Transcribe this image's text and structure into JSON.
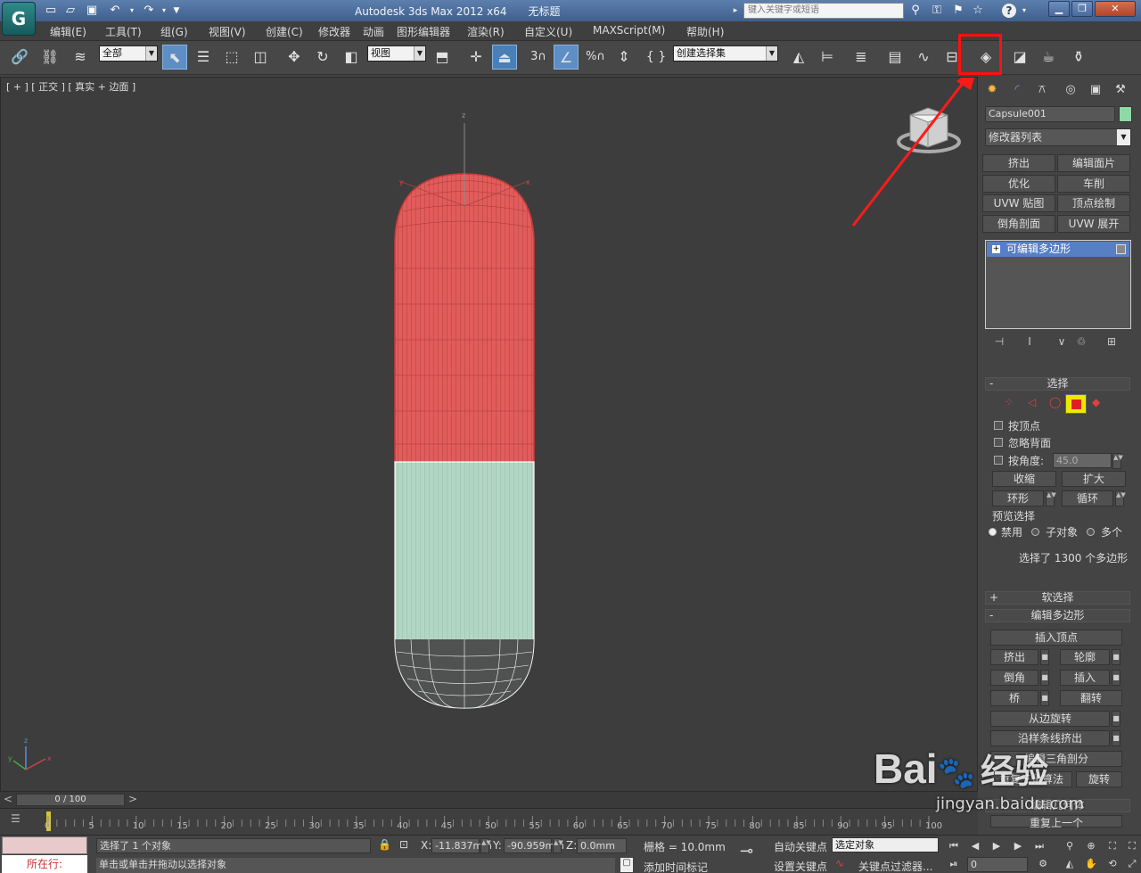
{
  "window": {
    "title": "Autodesk 3ds Max  2012 x64",
    "file": "无标题",
    "search_placeholder": "键入关键字或短语",
    "logo": "G"
  },
  "quick_access": [
    "new-icon",
    "open-icon",
    "save-icon",
    "undo-icon",
    "redo-icon"
  ],
  "menu": [
    "编辑(E)",
    "工具(T)",
    "组(G)",
    "视图(V)",
    "创建(C)",
    "修改器",
    "动画",
    "图形编辑器",
    "渲染(R)",
    "自定义(U)",
    "MAXScript(M)",
    "帮助(H)"
  ],
  "toolbar": {
    "selection_filter": "全部",
    "ref_coord": "视图",
    "named_selection": "创建选择集",
    "snap_label": "3",
    "percent_snap": "%",
    "highlighted_tool": "render-setup-icon"
  },
  "viewport": {
    "label": "[ + ] [ 正交 ] [ 真实 + 边面 ]",
    "axis_z": "z",
    "axis_x": "x",
    "axis_y": "y",
    "corner_axes": {
      "z": "z",
      "y": "y",
      "x": "x"
    },
    "selected_color": "#e85a5a",
    "unselected_color": "#b5d8c8"
  },
  "command_panel": {
    "object_name": "Capsule001",
    "object_color": "#8fd8a8",
    "modifier_list": "修改器列表",
    "modifier_buttons": [
      "挤出",
      "编辑面片",
      "优化",
      "车削",
      "UVW 贴图",
      "顶点绘制",
      "倒角剖面",
      "UVW 展开"
    ],
    "stack_item": "可编辑多边形",
    "selection": {
      "header": "选择",
      "by_vertex": "按顶点",
      "ignore_backfacing": "忽略背面",
      "by_angle": "按角度:",
      "angle_value": "45.0",
      "shrink": "收缩",
      "grow": "扩大",
      "ring": "环形",
      "loop": "循环",
      "preview_header": "预览选择",
      "preview_off": "禁用",
      "preview_sub": "子对象",
      "preview_multi": "多个",
      "status": "选择了 1300 个多边形"
    },
    "soft_selection": "软选择",
    "edit_polygons": {
      "header": "编辑多边形",
      "insert_vertex": "插入顶点",
      "extrude": "挤出",
      "outline": "轮廓",
      "bevel": "倒角",
      "inset": "插入",
      "bridge": "桥",
      "flip": "翻转",
      "hinge": "从边旋转",
      "extrude_spline": "沿样条线挤出",
      "edit_tri": "编辑三角剖分",
      "retri": "重复三角算法",
      "turn": "旋转"
    },
    "edit_geometry": "编辑几何体",
    "repeat_last": "重复上一个"
  },
  "timeline": {
    "frame": "0 / 100",
    "ticks": [
      "0",
      "5",
      "10",
      "15",
      "20",
      "25",
      "30",
      "35",
      "40",
      "45",
      "50",
      "55",
      "60",
      "65",
      "70",
      "75",
      "80",
      "85",
      "90",
      "95",
      "100"
    ]
  },
  "status": {
    "selected": "选择了 1 个对象",
    "prompt": "单击或单击并拖动以选择对象",
    "running": "所在行:",
    "x_label": "X:",
    "x": "-11.837mm",
    "y_label": "Y:",
    "y": "-90.959mm",
    "z_label": "Z:",
    "z": "0.0mm",
    "grid": "栅格 = 10.0mm",
    "auto_key": "自动关键点",
    "key_mode": "选定对象",
    "set_key": "设置关键点",
    "key_filters": "关键点过滤器...",
    "add_tag": "添加时间标记",
    "frame": "0"
  },
  "watermark": {
    "brand": "Bai",
    "paw": "du",
    "suffix": "经验",
    "url": "jingyan.baidu.com"
  }
}
